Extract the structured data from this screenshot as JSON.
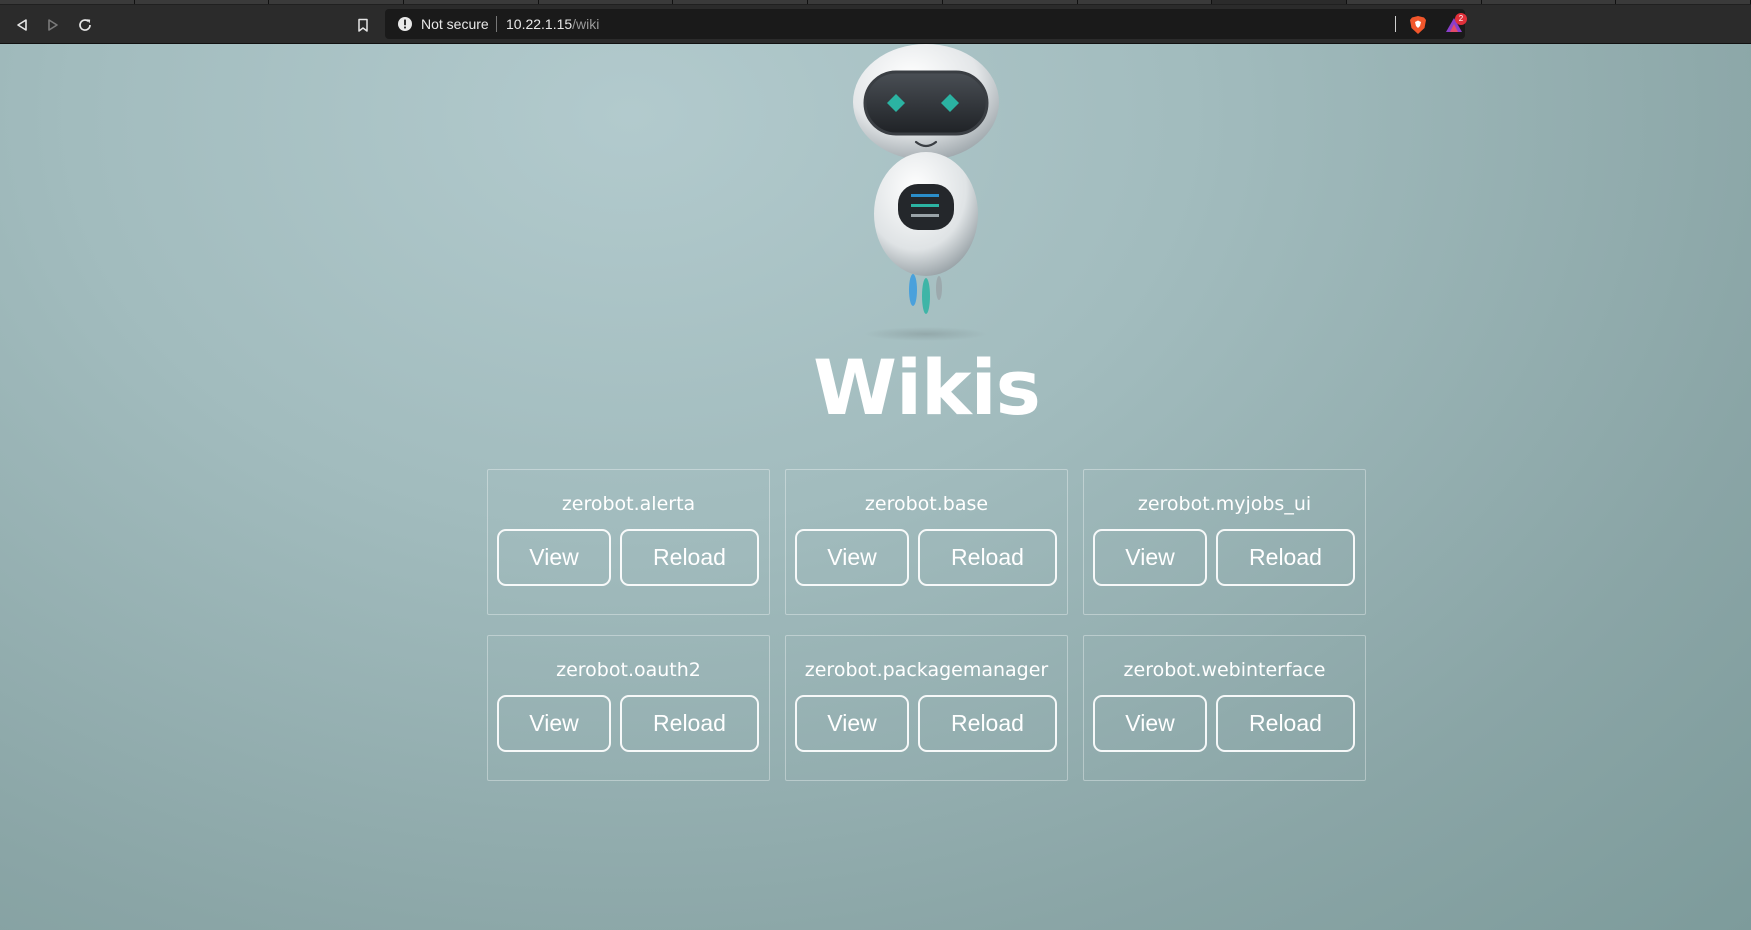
{
  "browser": {
    "security_label": "Not secure",
    "url_host": "10.22.1.15",
    "url_path": "/wiki",
    "rewards_badge": "2",
    "icons": {
      "back": "back-arrow-icon",
      "forward": "forward-arrow-icon",
      "reload": "reload-icon",
      "bookmark": "bookmark-icon",
      "info": "info-icon",
      "brave": "brave-shield-icon",
      "rewards": "brave-rewards-icon"
    }
  },
  "page": {
    "title": "Wikis",
    "logo": "robot-mascot-icon",
    "colors": {
      "background": "#a2bcbe",
      "text": "#ffffff"
    },
    "wikis": [
      {
        "name": "zerobot.alerta",
        "view_label": "View",
        "reload_label": "Reload"
      },
      {
        "name": "zerobot.base",
        "view_label": "View",
        "reload_label": "Reload"
      },
      {
        "name": "zerobot.myjobs_ui",
        "view_label": "View",
        "reload_label": "Reload"
      },
      {
        "name": "zerobot.oauth2",
        "view_label": "View",
        "reload_label": "Reload"
      },
      {
        "name": "zerobot.packagemanager",
        "view_label": "View",
        "reload_label": "Reload"
      },
      {
        "name": "zerobot.webinterface",
        "view_label": "View",
        "reload_label": "Reload"
      }
    ]
  }
}
